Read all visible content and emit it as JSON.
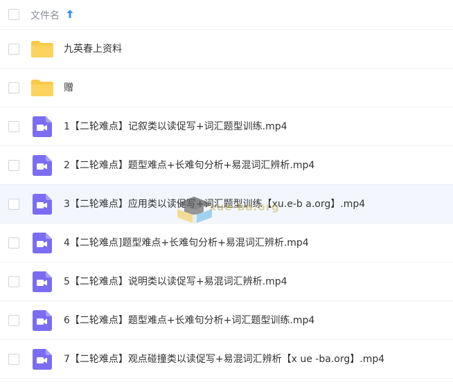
{
  "header": {
    "column_label": "文件名",
    "sort_direction": "ascending"
  },
  "files": [
    {
      "type": "folder",
      "name": "九英春上资料"
    },
    {
      "type": "folder",
      "name": "赠"
    },
    {
      "type": "video",
      "name": "1【二轮难点】记叙类以读促写+词汇题型训练.mp4"
    },
    {
      "type": "video",
      "name": "2【二轮难点】题型难点+长难句分析+易混词汇辨析.mp4"
    },
    {
      "type": "video",
      "name": "3【二轮难点】应用类以读促写+词汇题型训练【xu.e-b a.org】.mp4"
    },
    {
      "type": "video",
      "name": "4【二轮难点]题型难点+长难句分析+易混词汇辨析.mp4"
    },
    {
      "type": "video",
      "name": "5【二轮难点】说明类以读促写+易混词汇辨析.mp4"
    },
    {
      "type": "video",
      "name": "6【二轮难点】题型难点+长难句分析+词汇题型训练.mp4"
    },
    {
      "type": "video",
      "name": "7【二轮难点】观点碰撞类以读促写+易混词汇辨析【x ue -ba.org】.mp4"
    }
  ],
  "watermark": {
    "text": "xue-ba.org"
  },
  "colors": {
    "folder": "#f9c94a",
    "video": "#7b6df2",
    "sort_arrow": "#3b8cf6",
    "row_highlight": "#f3f7fd"
  }
}
